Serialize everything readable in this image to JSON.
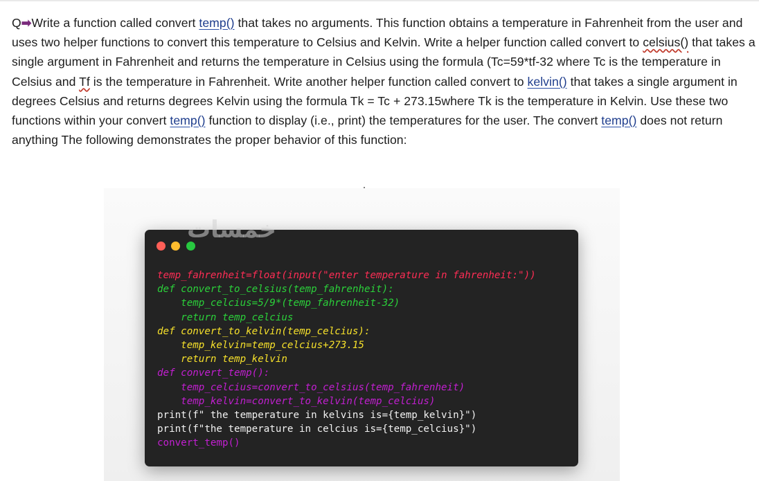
{
  "question": {
    "prefix": "Q",
    "seg1": "Write a function called convert ",
    "fn1": "temp()",
    "seg2": " that takes no arguments. This function obtains a temperature in Fahrenheit from the user and uses two helper functions to convert this temperature to Celsius and Kelvin. Write a helper function called convert to ",
    "fn2": "celsius()",
    "seg3": " that takes a single argument in Fahrenheit and returns the temperature in Celsius using the formula (Tc=59*tf-32 where Tc is the temperature in Celsius and ",
    "tf": "Tf",
    "seg4": " is the temperature in Fahrenheit. Write another helper function called convert to ",
    "fn3": "kelvin()",
    "seg5": " that takes a single argument in degrees Celsius and returns degrees Kelvin using the formula Tk = Tc + 273.15where Tk is the temperature in Kelvin. Use these two functions within your convert ",
    "fn4": "temp()",
    "seg6": " function to display (i.e., print) the temperatures for the user. The convert ",
    "fn5": "temp()",
    "seg7": " does not return anything The following demonstrates the proper behavior of this function:"
  },
  "code_window": {
    "lines": [
      {
        "text": "temp_fahrenheit=float(input(\"enter temperature in fahrenheit:\"))",
        "color": "red",
        "italic": true
      },
      {
        "text": "def convert_to_celsius(temp_fahrenheit):",
        "color": "green",
        "italic": true
      },
      {
        "text": "    temp_celcius=5/9*(temp_fahrenheit-32)",
        "color": "green",
        "italic": true
      },
      {
        "text": "    return temp_celcius",
        "color": "green",
        "italic": true
      },
      {
        "text": "def convert_to_kelvin(temp_celcius):",
        "color": "yellow",
        "italic": true
      },
      {
        "text": "    temp_kelvin=temp_celcius+273.15",
        "color": "yellow",
        "italic": true
      },
      {
        "text": "    return temp_kelvin",
        "color": "yellow",
        "italic": true
      },
      {
        "text": "def convert_temp():",
        "color": "purple",
        "italic": true
      },
      {
        "text": "    temp_celcius=convert_to_celsius(temp_fahrenheit)",
        "color": "purple",
        "italic": true
      },
      {
        "text": "    temp_kelvin=convert_to_kelvin(temp_celcius)",
        "color": "purple",
        "italic": true
      },
      {
        "text": "print(f\" the temperature in kelvins is={temp_kelvin}\")",
        "color": "white",
        "italic": false
      },
      {
        "text": "print(f\"the temperature in celcius is={temp_celcius}\")",
        "color": "white",
        "italic": false
      },
      {
        "text": "convert_temp()",
        "color": "purple",
        "italic": false
      }
    ]
  },
  "watermark": "خمسات",
  "colors": {
    "red": "#ff2d55",
    "green": "#2bd13a",
    "yellow": "#f7e12b",
    "purple": "#c21fd1",
    "white": "#f2f2f2",
    "link": "#1d3c8c",
    "arrow": "#7a2a7c"
  },
  "icons": {
    "arrow": "right-arrow-icon",
    "window_controls": [
      "close-dot-icon",
      "minimize-dot-icon",
      "maximize-dot-icon"
    ]
  }
}
